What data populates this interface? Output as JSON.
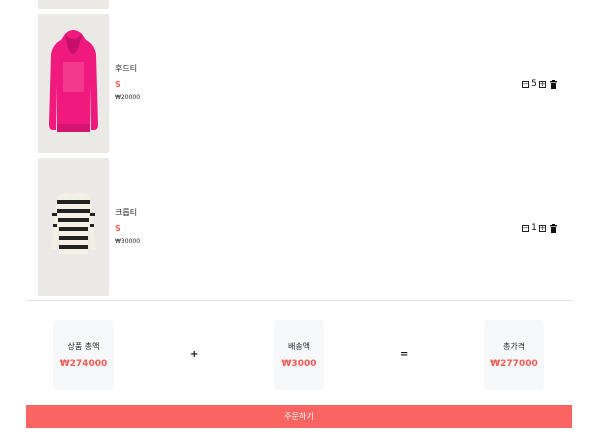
{
  "cart": {
    "items": [
      {
        "name": "",
        "size": "",
        "price": "",
        "quantity": ""
      },
      {
        "name": "후드티",
        "size": "S",
        "price": "₩20000",
        "quantity": "5",
        "image": "pink-hoodie-image"
      },
      {
        "name": "크롭티",
        "size": "S",
        "price": "₩30000",
        "quantity": "1",
        "image": "striped-sweater-image"
      }
    ]
  },
  "summary": {
    "subtotal_label": "상품 총액",
    "subtotal_value": "₩274000",
    "plus_symbol": "+",
    "shipping_label": "배송액",
    "shipping_value": "₩3000",
    "equals_symbol": "=",
    "total_label": "총가격",
    "total_value": "₩277000"
  },
  "order_button": {
    "label": "주문하기"
  },
  "colors": {
    "accent": "#f35b57",
    "button": "#fa6462",
    "card": "#f7f8f9",
    "thumb_bg": "#ebe9e6"
  },
  "icons": {
    "minus": "minus-square-icon",
    "plus": "plus-square-icon",
    "delete": "trash-icon"
  }
}
